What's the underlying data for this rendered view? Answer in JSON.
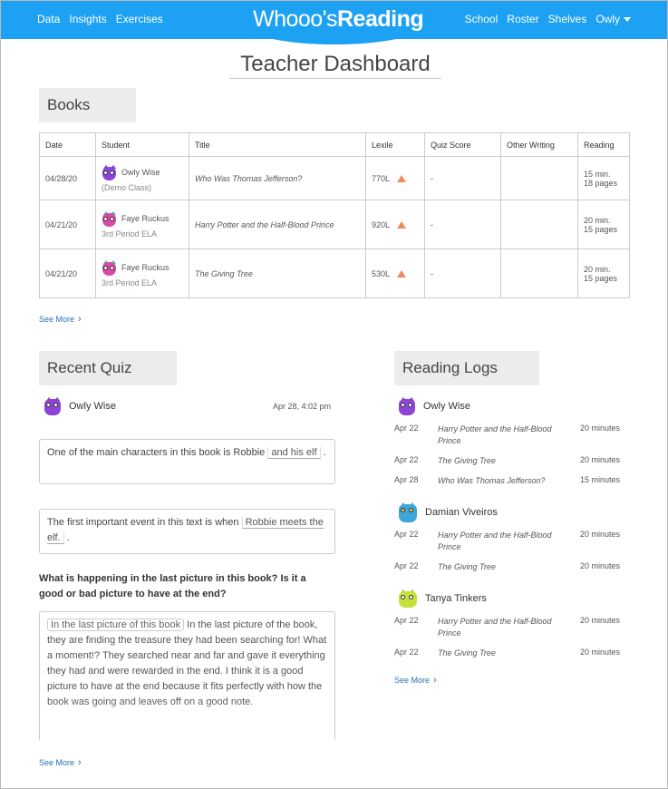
{
  "header": {
    "nav_left": [
      "Data",
      "Insights",
      "Exercises"
    ],
    "logo_light": "Whooo's",
    "logo_bold": "Reading",
    "nav_right": [
      "School",
      "Roster",
      "Shelves"
    ],
    "user_menu": "Owly"
  },
  "page_title": "Teacher Dashboard",
  "books": {
    "heading": "Books",
    "columns": [
      "Date",
      "Student",
      "Title",
      "Lexile",
      "Quiz Score",
      "Other Writing",
      "Reading"
    ],
    "rows": [
      {
        "date": "04/28/20",
        "student": "Owly Wise",
        "class": "(Demo Class)",
        "title": "Who Was Thomas Jefferson?",
        "lexile": "770L",
        "quiz": "-",
        "other": "",
        "reading_min": "15 min.",
        "reading_pages": "18 pages"
      },
      {
        "date": "04/21/20",
        "student": "Faye Ruckus",
        "class": "3rd Period ELA",
        "title": "Harry Potter and the Half-Blood Prince",
        "lexile": "920L",
        "quiz": "-",
        "other": "",
        "reading_min": "20 min.",
        "reading_pages": "15 pages"
      },
      {
        "date": "04/21/20",
        "student": "Faye Ruckus",
        "class": "3rd Period ELA",
        "title": "The Giving Tree",
        "lexile": "530L",
        "quiz": "-",
        "other": "",
        "reading_min": "20 min.",
        "reading_pages": "15 pages"
      }
    ],
    "see_more": "See More"
  },
  "recent_quiz": {
    "heading": "Recent Quiz",
    "user": "Owly Wise",
    "date": "Apr 28, 4:02 pm",
    "q1_before": "One of the main characters in this book is Robbie",
    "q1_answer": "and his elf",
    "q1_after": ".",
    "q2_before": "The first important event in this text is when",
    "q2_answer": "Robbie meets the elf.",
    "q2_after": ".",
    "q3_prompt": "What is happening in the last picture in this book? Is it a good or bad picture to have at the end?",
    "q3_pill": "In the last picture of this book",
    "q3_answer": "In the last picture of the book, they are finding the treasure they had been searching for! What a moment!? They searched near and far and gave it everything they had and were rewarded in the end. I think it is a good picture to have at the end because it fits perfectly with how the book was going and leaves off on a good note.",
    "see_more": "See More"
  },
  "reading_logs": {
    "heading": "Reading Logs",
    "students": [
      {
        "name": "Owly Wise",
        "entries": [
          {
            "date": "Apr 22",
            "title": "Harry Potter and the Half-Blood Prince",
            "minutes": "20 minutes"
          },
          {
            "date": "Apr 22",
            "title": "The Giving Tree",
            "minutes": "20 minutes"
          },
          {
            "date": "Apr 28",
            "title": "Who Was Thomas Jefferson?",
            "minutes": "15 minutes"
          }
        ]
      },
      {
        "name": "Damian Viveiros",
        "entries": [
          {
            "date": "Apr 22",
            "title": "Harry Potter and the Half-Blood Prince",
            "minutes": "20 minutes"
          },
          {
            "date": "Apr 22",
            "title": "The Giving Tree",
            "minutes": "20 minutes"
          }
        ]
      },
      {
        "name": "Tanya Tinkers",
        "entries": [
          {
            "date": "Apr 22",
            "title": "Harry Potter and the Half-Blood Prince",
            "minutes": "20 minutes"
          },
          {
            "date": "Apr 22",
            "title": "The Giving Tree",
            "minutes": "20 minutes"
          }
        ]
      }
    ],
    "see_more": "See More"
  },
  "colors": {
    "brand": "#1da1f2",
    "link": "#2a6fb2",
    "lexile_marker": "#ef8a5b"
  }
}
